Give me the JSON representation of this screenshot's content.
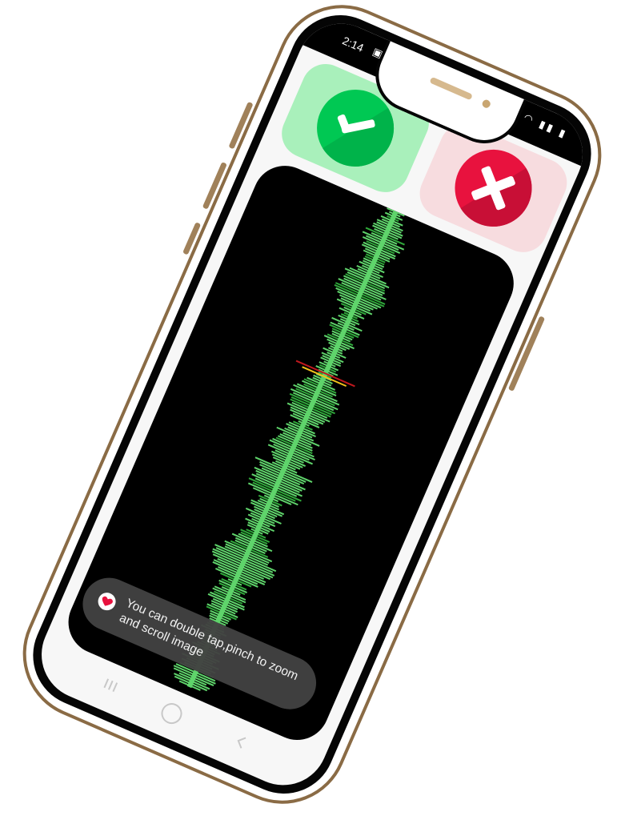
{
  "status_bar": {
    "time": "2:14",
    "left_icons": "▣ ▨",
    "right_icons": "◠ ▮▮ ▮"
  },
  "actions": {
    "approve_icon": "check-icon",
    "approve_color": "#00c853",
    "reject_icon": "close-icon",
    "reject_color": "#e8123e"
  },
  "viewer": {
    "background": "#000000",
    "waveform_color": "#5fd46b",
    "marker_colors": [
      "#c0181e",
      "#f2c21a"
    ]
  },
  "toast": {
    "message": "You can double tap,pinch to zoom and scroll image",
    "icon": "heart-app-icon"
  },
  "nav": {
    "recents": "recents-icon",
    "home": "home-icon",
    "back": "back-icon"
  }
}
